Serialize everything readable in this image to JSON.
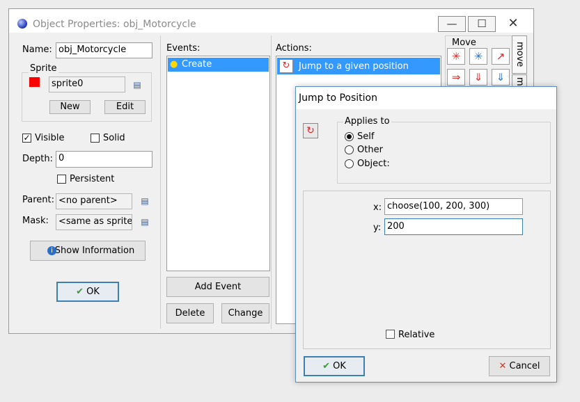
{
  "window": {
    "title": "Object Properties: obj_Motorcycle",
    "controls": {
      "minimize": "—",
      "maximize": "☐",
      "close": "✕"
    }
  },
  "props": {
    "name_label": "Name:",
    "name_value": "obj_Motorcycle",
    "sprite_group": "Sprite",
    "sprite_value": "sprite0",
    "sprite_color": "#ff0000",
    "new_label": "New",
    "edit_label": "Edit",
    "visible_label": "Visible",
    "visible_checked": "✓",
    "solid_label": "Solid",
    "depth_label": "Depth:",
    "depth_value": "0",
    "persistent_label": "Persistent",
    "parent_label": "Parent:",
    "parent_value": "<no parent>",
    "mask_label": "Mask:",
    "mask_value": "<same as sprite>",
    "show_info_label": "Show Information",
    "ok_label": "OK"
  },
  "events": {
    "header": "Events:",
    "items": [
      "Create"
    ],
    "add_event": "Add Event",
    "delete": "Delete",
    "change": "Change"
  },
  "actions": {
    "header": "Actions:",
    "items": [
      "Jump to a given position"
    ]
  },
  "palette": {
    "group_label": "Move",
    "tab_move": "move",
    "tab_next": "m"
  },
  "dialog": {
    "title": "Jump to Position",
    "applies_to_label": "Applies to",
    "self_label": "Self",
    "other_label": "Other",
    "object_label": "Object:",
    "x_label": "x:",
    "x_value": "choose(100, 200, 300)",
    "y_label": "y:",
    "y_value": "200",
    "relative_label": "Relative",
    "ok_label": "OK",
    "cancel_label": "Cancel"
  },
  "colors": {
    "selection": "#3399ff",
    "accent_border": "#3c7fb1",
    "ok_check": "#3a9a3a",
    "cancel_x": "#c0392b"
  }
}
